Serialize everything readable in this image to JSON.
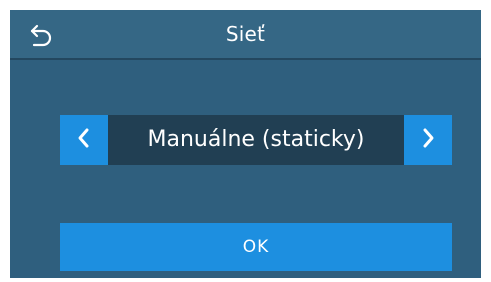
{
  "header": {
    "title": "Sieť",
    "back_icon": "back-arrow-icon"
  },
  "selector": {
    "value": "Manuálne (staticky)",
    "prev_icon": "chevron-left-icon",
    "next_icon": "chevron-right-icon"
  },
  "actions": {
    "ok_label": "OK"
  },
  "colors": {
    "background": "#2f5f7e",
    "header": "#356785",
    "accent": "#1d8fe0",
    "value_background": "#213f53",
    "text": "#ffffff"
  }
}
